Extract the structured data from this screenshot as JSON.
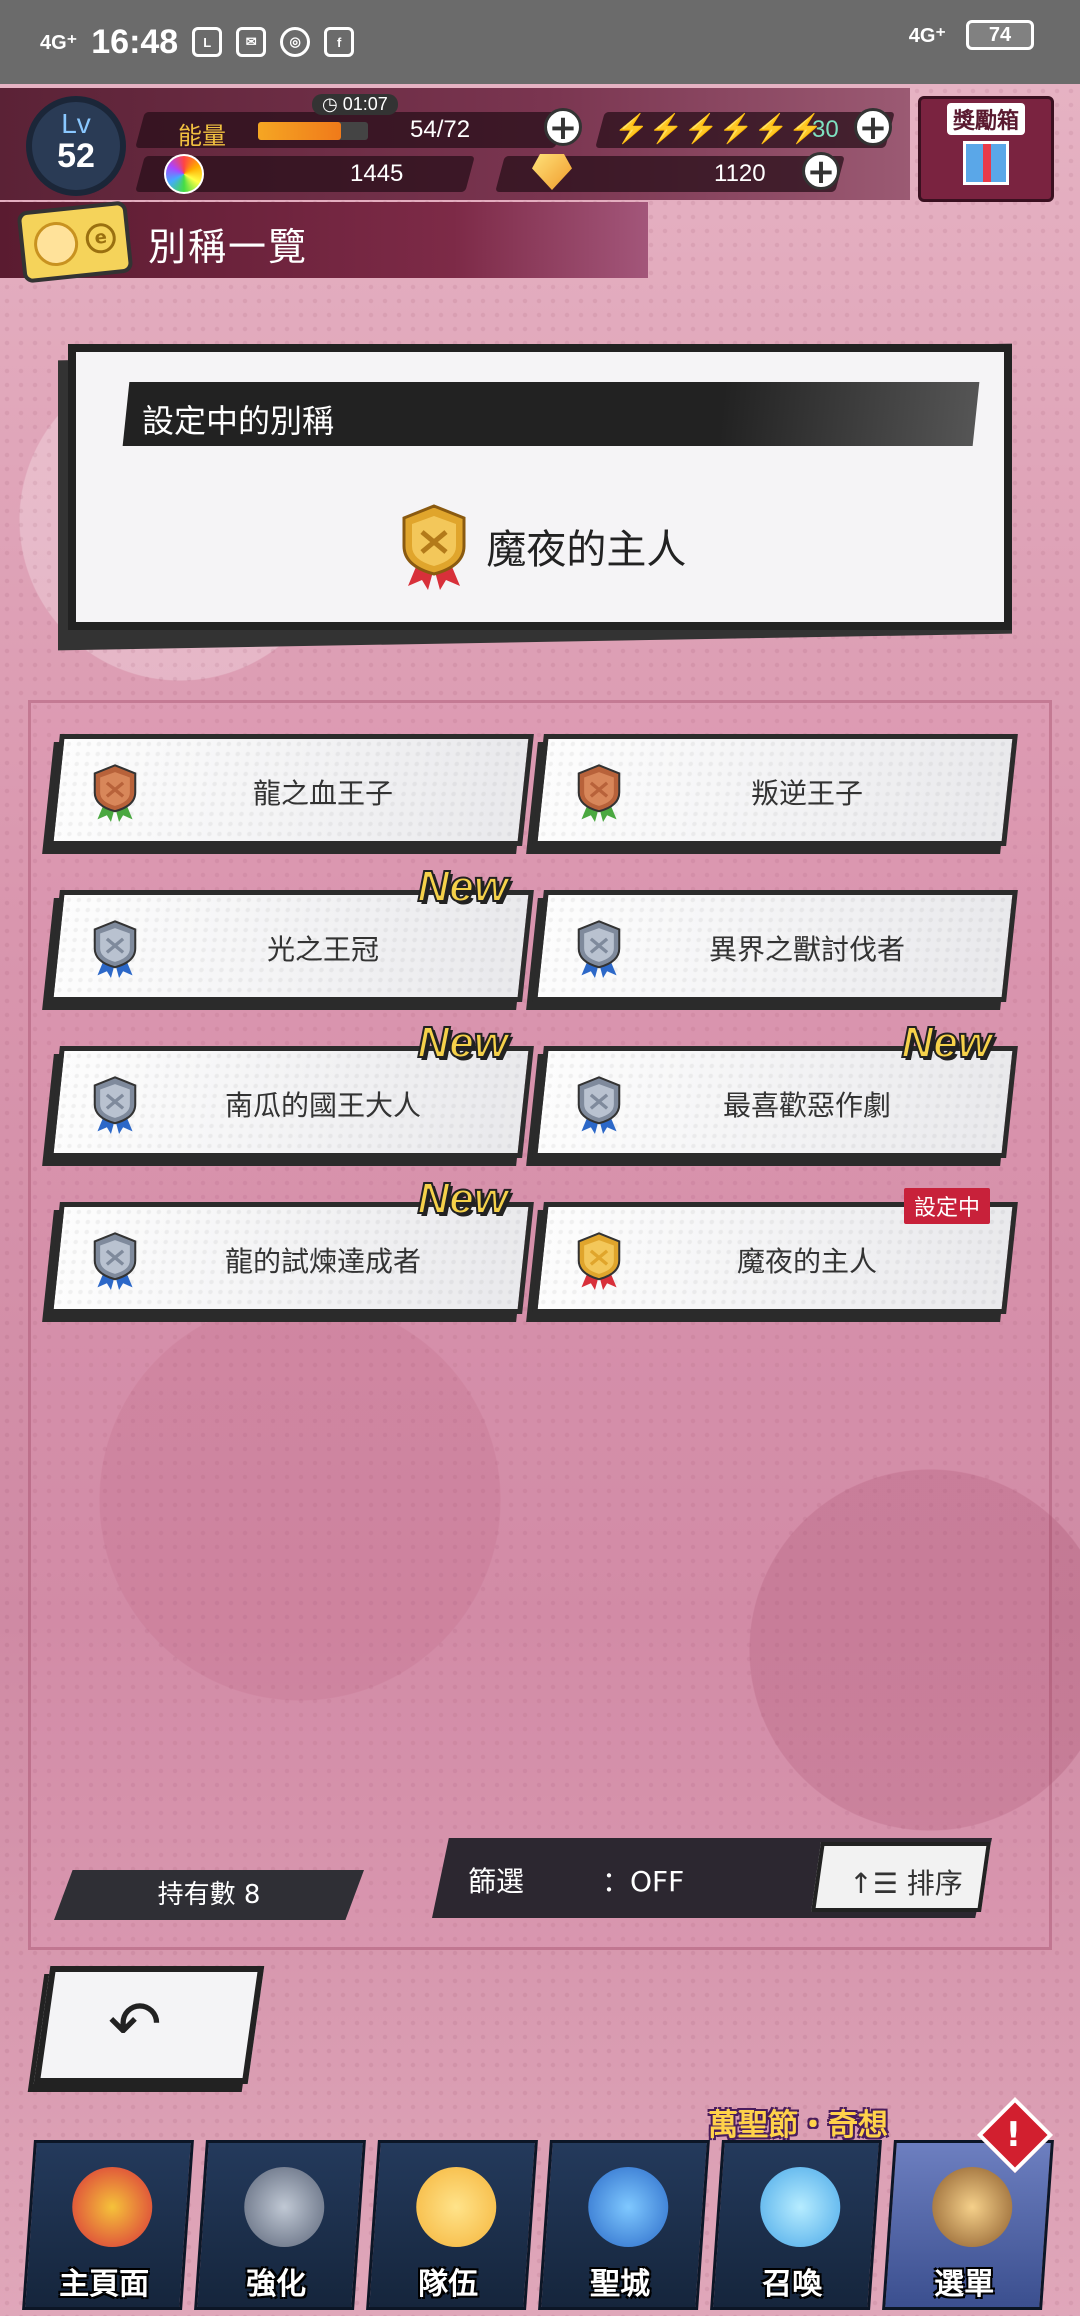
{
  "status_bar": {
    "network_left": "4G⁺",
    "time": "16:48",
    "notif_icons": [
      "line-icon",
      "mail-icon",
      "chrome-icon",
      "facebook-icon"
    ],
    "network_right": "4G⁺",
    "battery": "74"
  },
  "hud": {
    "level_label": "Lv",
    "level": "52",
    "energy_label": "能量",
    "energy_timer": "01:07",
    "energy_value": "54/72",
    "energy_fill": 0.75,
    "stamina_value": "30",
    "orb_value": "1445",
    "gem_value": "1120",
    "gift_label": "獎勵箱"
  },
  "header": {
    "title": "別稱一覽"
  },
  "current": {
    "heading": "設定中的別稱",
    "name": "魔夜的主人",
    "medal": "gold"
  },
  "titles": [
    {
      "label": "龍之血王子",
      "medal": "bronze",
      "new": false,
      "set": false
    },
    {
      "label": "叛逆王子",
      "medal": "bronze",
      "new": false,
      "set": false
    },
    {
      "label": "光之王冠",
      "medal": "silver",
      "new": true,
      "set": false
    },
    {
      "label": "異界之獸討伐者",
      "medal": "silver",
      "new": false,
      "set": false
    },
    {
      "label": "南瓜的國王大人",
      "medal": "silver",
      "new": true,
      "set": false
    },
    {
      "label": "最喜歡惡作劇",
      "medal": "silver",
      "new": true,
      "set": false
    },
    {
      "label": "龍的試煉達成者",
      "medal": "silver",
      "new": true,
      "set": false
    },
    {
      "label": "魔夜的主人",
      "medal": "gold",
      "new": false,
      "set": true
    }
  ],
  "badges": {
    "new_label": "New",
    "set_label": "設定中"
  },
  "controls": {
    "count_label": "持有數 8",
    "filter_label": "篩選",
    "filter_value": "：OFF",
    "sort_label": "排序"
  },
  "nav": {
    "event_label": "萬聖節・奇想",
    "items": [
      {
        "label": "主頁面",
        "icon": "home-icon"
      },
      {
        "label": "強化",
        "icon": "hammer-icon"
      },
      {
        "label": "隊伍",
        "icon": "team-icon"
      },
      {
        "label": "聖城",
        "icon": "castle-icon"
      },
      {
        "label": "召喚",
        "icon": "crystal-icon"
      },
      {
        "label": "選單",
        "icon": "book-icon"
      }
    ]
  },
  "colors": {
    "gold": "#e0a52c",
    "silver": "#8a96a8",
    "bronze": "#b8623a",
    "accent": "#7a2a47"
  }
}
